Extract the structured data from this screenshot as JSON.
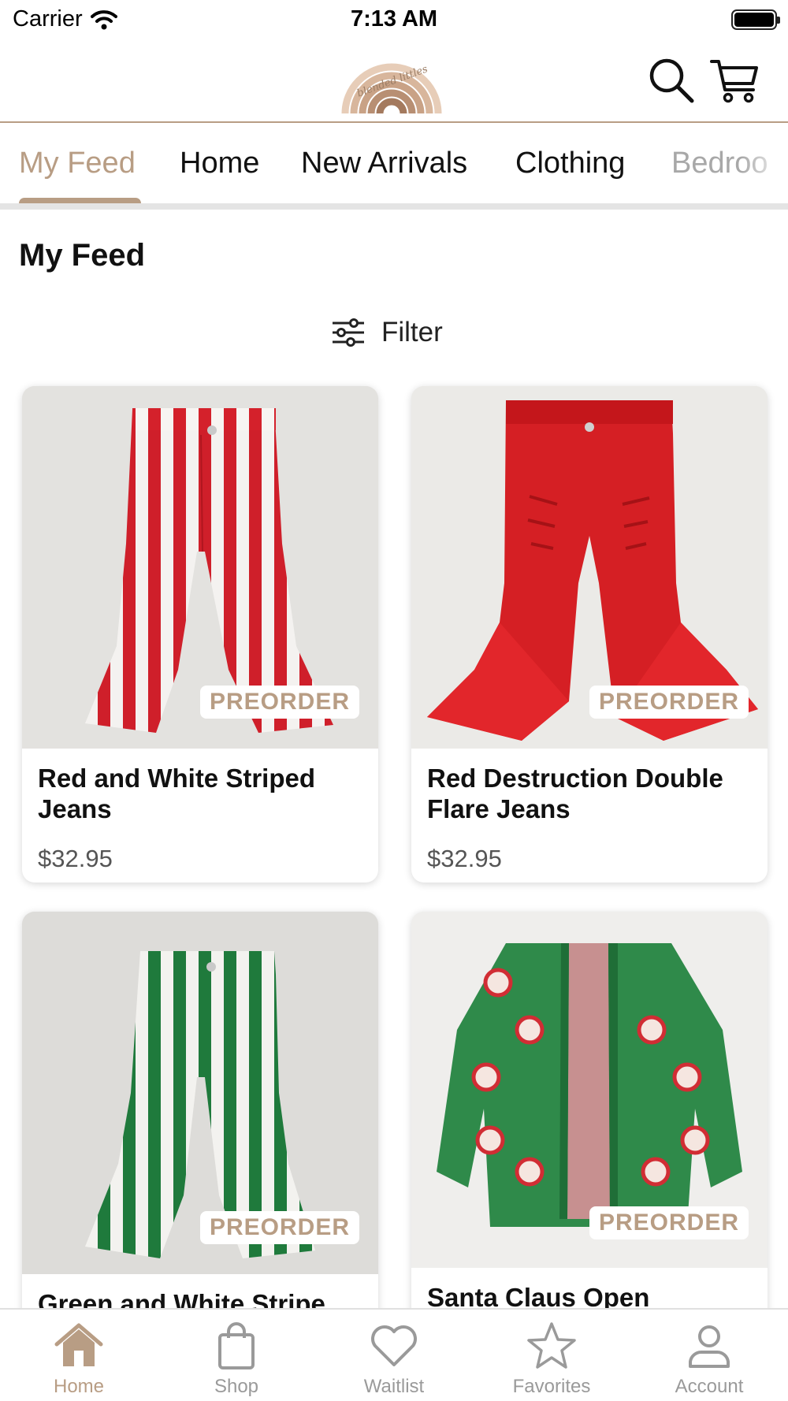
{
  "status_bar": {
    "carrier": "Carrier",
    "time": "7:13 AM"
  },
  "brand": {
    "logo_text": "blended littles"
  },
  "colors": {
    "accent": "#b89d84",
    "text": "#111111",
    "muted": "#9a9a9a"
  },
  "tabs": [
    {
      "label": "My Feed",
      "active": true
    },
    {
      "label": "Home"
    },
    {
      "label": "New Arrivals"
    },
    {
      "label": "Clothing"
    },
    {
      "label": "Bedroo"
    }
  ],
  "page_title": "My Feed",
  "filter": {
    "label": "Filter",
    "icon": "sliders-icon"
  },
  "products": [
    {
      "name": "Red and White Striped Jeans",
      "price": "$32.95",
      "badge": "PREORDER"
    },
    {
      "name": "Red Destruction Double Flare Jeans",
      "price": "$32.95",
      "badge": "PREORDER"
    },
    {
      "name": "Green and White Stripe",
      "price": "",
      "badge": "PREORDER"
    },
    {
      "name": "Santa Claus Open",
      "price": "",
      "badge": "PREORDER"
    }
  ],
  "bottom_nav": [
    {
      "label": "Home",
      "icon": "home-icon",
      "active": true
    },
    {
      "label": "Shop",
      "icon": "bag-icon"
    },
    {
      "label": "Waitlist",
      "icon": "heart-icon"
    },
    {
      "label": "Favorites",
      "icon": "star-icon"
    },
    {
      "label": "Account",
      "icon": "person-icon"
    }
  ]
}
